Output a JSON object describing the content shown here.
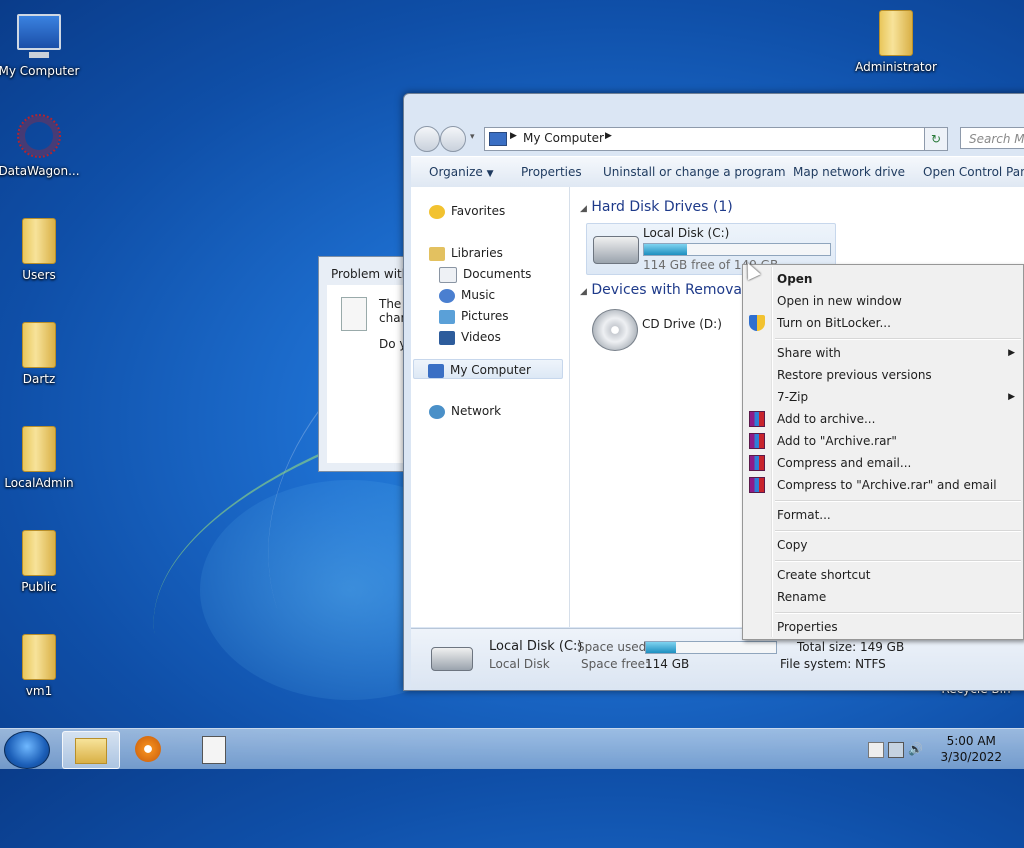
{
  "desktop": {
    "icons": [
      {
        "label": "My Computer",
        "icon": "computer-icon"
      },
      {
        "label": "DataWagon...",
        "icon": "datawagon-shortcut-icon"
      },
      {
        "label": "Users",
        "icon": "folder-icon"
      },
      {
        "label": "Dartz",
        "icon": "folder-icon"
      },
      {
        "label": "LocalAdmin",
        "icon": "folder-icon"
      },
      {
        "label": "Public",
        "icon": "folder-icon"
      },
      {
        "label": "vm1",
        "icon": "folder-icon"
      },
      {
        "label": "Administrator",
        "icon": "folder-icon"
      },
      {
        "label": "Recycle Bin",
        "icon": "recycle-bin-icon"
      }
    ]
  },
  "dialog": {
    "title": "Problem with",
    "line1": "The i",
    "line2": "chan",
    "line3": "Do yo"
  },
  "explorer": {
    "address": "My Computer",
    "search_placeholder": "Search My C",
    "toolbar": {
      "organize": "Organize",
      "properties": "Properties",
      "uninstall": "Uninstall or change a program",
      "map_drive": "Map network drive",
      "control_panel": "Open Control Panel"
    },
    "nav": {
      "favorites": "Favorites",
      "libraries": "Libraries",
      "documents": "Documents",
      "music": "Music",
      "pictures": "Pictures",
      "videos": "Videos",
      "my_computer": "My Computer",
      "network": "Network"
    },
    "groups": {
      "hdd": "Hard Disk Drives (1)",
      "removable": "Devices with Removab"
    },
    "drives": {
      "c_name": "Local Disk (C:)",
      "c_free": "114 GB free of 149 GB",
      "c_used_fraction": 0.23,
      "d_name": "CD Drive (D:)"
    },
    "details": {
      "name": "Local Disk (C:)",
      "type": "Local Disk",
      "space_used_label": "Space used:",
      "space_free_label": "Space free:",
      "space_free": "114 GB",
      "total_size": "Total size: 149 GB",
      "file_system": "File system: NTFS"
    }
  },
  "context_menu": {
    "open": "Open",
    "open_new_window": "Open in new window",
    "bitlocker": "Turn on BitLocker...",
    "share_with": "Share with",
    "restore": "Restore previous versions",
    "zip": "7-Zip",
    "add_archive": "Add to archive...",
    "add_archive_rar": "Add to \"Archive.rar\"",
    "compress_email": "Compress and email...",
    "compress_rar_email": "Compress to \"Archive.rar\" and email",
    "format": "Format...",
    "copy": "Copy",
    "create_shortcut": "Create shortcut",
    "rename": "Rename",
    "properties": "Properties"
  },
  "taskbar": {
    "time": "5:00 AM",
    "date": "3/30/2022"
  }
}
